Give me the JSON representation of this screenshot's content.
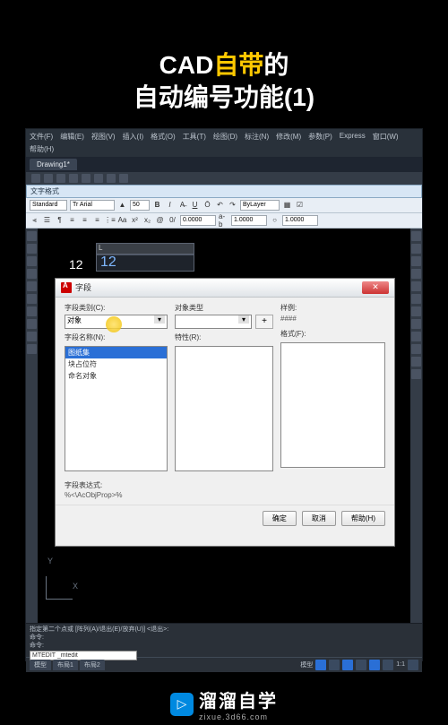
{
  "title": {
    "line1_a": "CAD",
    "line1_b": "自带",
    "line1_c": "的",
    "line2": "自动编号功能(1)"
  },
  "menubar": [
    "文件(F)",
    "编辑(E)",
    "视图(V)",
    "插入(I)",
    "格式(O)",
    "工具(T)",
    "绘图(D)",
    "标注(N)",
    "修改(M)",
    "参数(P)",
    "Express",
    "窗口(W)",
    "帮助(H)"
  ],
  "doc_tab": "Drawing1*",
  "text_format_title": "文字格式",
  "text_toolbar": {
    "style": "Standard",
    "font": "Tr Arial",
    "size": "50",
    "layer": "ByLayer",
    "val1": "0.0000",
    "val2": "1.0000",
    "val3": "1.0000"
  },
  "canvas": {
    "label_12": "12",
    "input_12": "12"
  },
  "ucs": {
    "y": "Y",
    "x": "X"
  },
  "dialog": {
    "title": "字段",
    "cat_label": "字段类别(C):",
    "cat_value": "对象",
    "name_label": "字段名称(N):",
    "list": [
      "图纸集",
      "块占位符",
      "命名对象"
    ],
    "objtype_label": "对象类型",
    "prop_label": "特性(R):",
    "sample_label": "样例:",
    "sample_value": "####",
    "format_label": "格式(F):",
    "plus": "+",
    "expr_label": "字段表达式:",
    "expr_value": "%<\\AcObjProp>%",
    "ok": "确定",
    "cancel": "取消",
    "help": "帮助(H)"
  },
  "cmdline": {
    "l1": "指定第二个点或 [阵列(A)/退出(E)/放弃(U)] <退出>:",
    "l2": "命令:",
    "l3": "命令:",
    "input": "MTEDIT _mtedit"
  },
  "status": {
    "tabs": [
      "模型",
      "布局1",
      "布局2"
    ],
    "model": "模型",
    "scale": "1:1"
  },
  "watermark": {
    "main": "溜溜自学",
    "sub": "zixue.3d66.com"
  }
}
